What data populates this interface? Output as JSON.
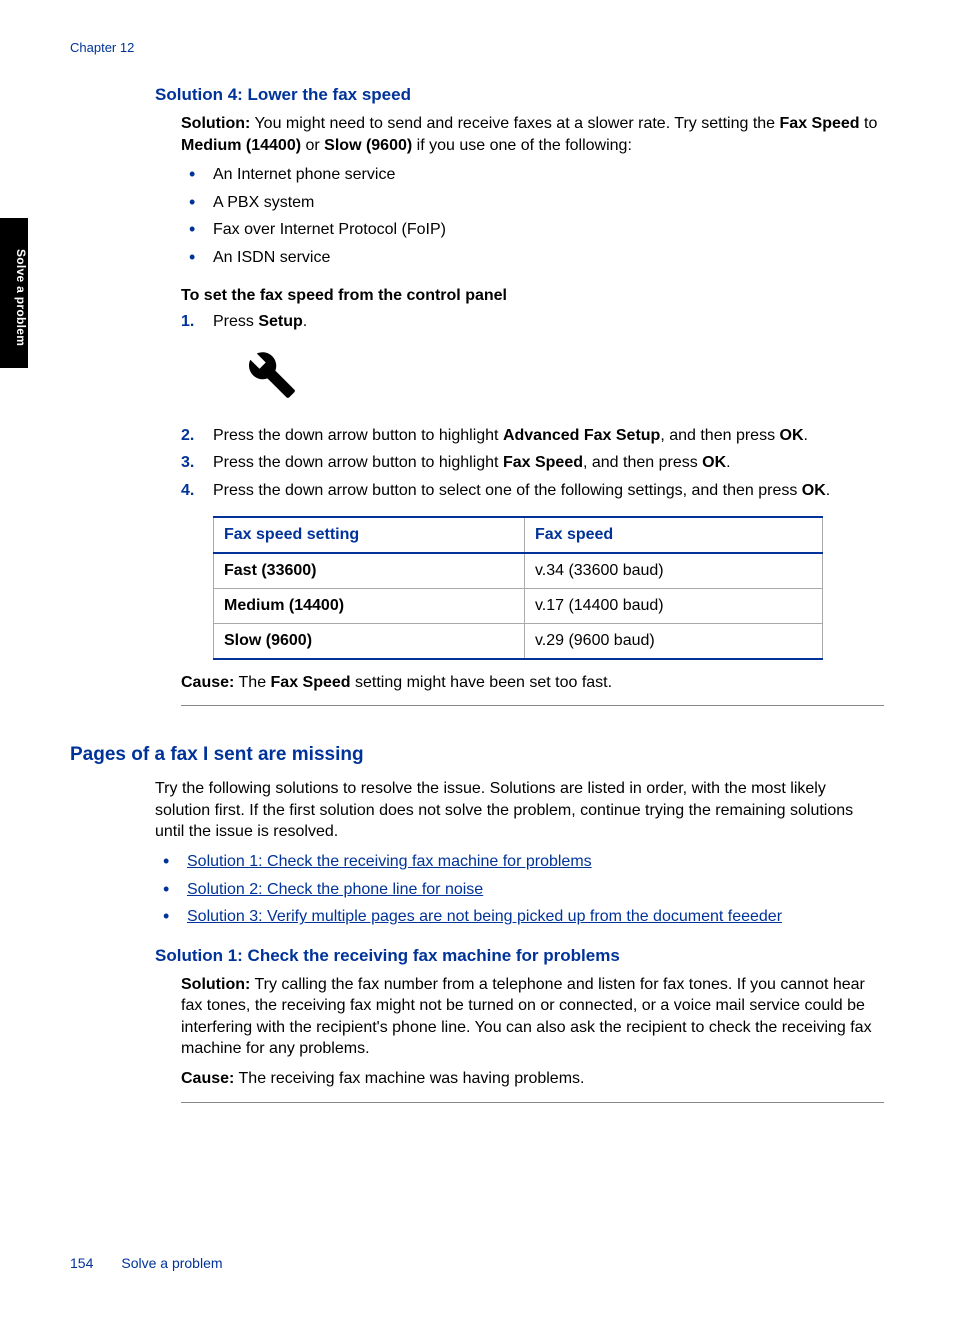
{
  "header": {
    "chapter": "Chapter 12"
  },
  "sideTab": "Solve a problem",
  "solution4": {
    "heading": "Solution 4: Lower the fax speed",
    "solutionLabel": "Solution:",
    "solutionTextPart1": "   You might need to send and receive faxes at a slower rate. Try setting the ",
    "faxSpeedBold": "Fax Speed",
    "solutionTextPart2": " to ",
    "medium": "Medium (14400)",
    "solutionTextPart3": " or ",
    "slow": "Slow (9600)",
    "solutionTextPart4": " if you use one of the following:",
    "bullets": [
      "An Internet phone service",
      "A PBX system",
      "Fax over Internet Protocol (FoIP)",
      "An ISDN service"
    ],
    "procHeading": "To set the fax speed from the control panel",
    "step1_pre": "Press ",
    "step1_bold": "Setup",
    "step1_post": ".",
    "step2_pre": "Press the down arrow button to highlight ",
    "step2_bold": "Advanced Fax Setup",
    "step2_mid": ", and then press ",
    "step2_bold2": "OK",
    "step2_post": ".",
    "step3_pre": "Press the down arrow button to highlight ",
    "step3_bold": "Fax Speed",
    "step3_mid": ", and then press ",
    "step3_bold2": "OK",
    "step3_post": ".",
    "step4_pre": "Press the down arrow button to select one of the following settings, and then press ",
    "step4_bold": "OK",
    "step4_post": ".",
    "table": {
      "h1": "Fax speed setting",
      "h2": "Fax speed",
      "rows": [
        {
          "c1": "Fast (33600)",
          "c2": "v.34 (33600 baud)"
        },
        {
          "c1": "Medium (14400)",
          "c2": "v.17 (14400 baud)"
        },
        {
          "c1": "Slow (9600)",
          "c2": "v.29 (9600 baud)"
        }
      ]
    },
    "causeLabel": "Cause:",
    "causePre": "   The ",
    "causeBold": "Fax Speed",
    "causePost": " setting might have been set too fast."
  },
  "pagesMissing": {
    "heading": "Pages of a fax I sent are missing",
    "intro": "Try the following solutions to resolve the issue. Solutions are listed in order, with the most likely solution first. If the first solution does not solve the problem, continue trying the remaining solutions until the issue is resolved.",
    "links": [
      "Solution 1: Check the receiving fax machine for problems",
      "Solution 2: Check the phone line for noise",
      "Solution 3: Verify multiple pages are not being picked up from the document feeeder"
    ]
  },
  "solution1": {
    "heading": "Solution 1: Check the receiving fax machine for problems",
    "solutionLabel": "Solution:",
    "solutionText": "   Try calling the fax number from a telephone and listen for fax tones. If you cannot hear fax tones, the receiving fax might not be turned on or connected, or a voice mail service could be interfering with the recipient's phone line. You can also ask the recipient to check the receiving fax machine for any problems.",
    "causeLabel": "Cause:",
    "causeText": "   The receiving fax machine was having problems."
  },
  "footer": {
    "pageNum": "154",
    "title": "Solve a problem"
  }
}
